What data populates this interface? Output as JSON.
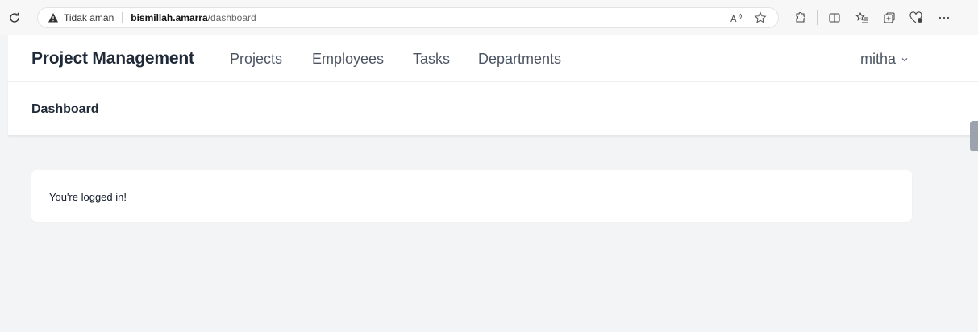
{
  "browser": {
    "security_label": "Tidak aman",
    "host": "bismillah.amarra",
    "path": "/dashboard"
  },
  "nav": {
    "brand": "Project Management",
    "links": [
      "Projects",
      "Employees",
      "Tasks",
      "Departments"
    ],
    "user": "mitha"
  },
  "header": {
    "title": "Dashboard"
  },
  "content": {
    "message": "You're logged in!"
  }
}
